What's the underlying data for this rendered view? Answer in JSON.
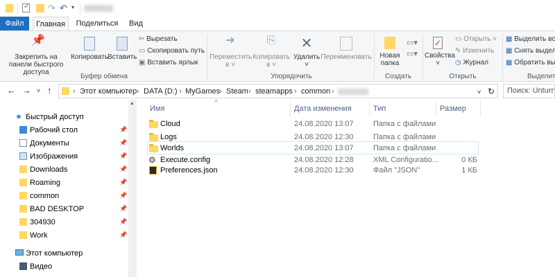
{
  "quick_access_toolbar": {
    "icons": [
      "folder-icon",
      "properties-check-icon",
      "new-folder-icon",
      "redo-icon",
      "undo-icon",
      "customize-dropdown-icon"
    ]
  },
  "ribbon_tabs": [
    {
      "label": "Файл"
    },
    {
      "label": "Главная"
    },
    {
      "label": "Поделиться"
    },
    {
      "label": "Вид"
    }
  ],
  "ribbon": {
    "clipboard": {
      "pin_label": "Закрепить на панели быстрого доступа",
      "copy_label": "Копировать",
      "paste_label": "Вставить",
      "cut_label": "Вырезать",
      "copy_path_label": "Скопировать путь",
      "paste_shortcut_label": "Вставить ярлык",
      "group_label": "Буфер обмена"
    },
    "organize": {
      "move_to_label": "Переместить в ˅",
      "copy_to_label": "Копировать в ˅",
      "delete_label": "Удалить ˅",
      "rename_label": "Переименовать",
      "group_label": "Упорядочить"
    },
    "new": {
      "new_folder_label": "Новая папка",
      "group_label": "Создать"
    },
    "open": {
      "properties_label": "Свойства ˅",
      "open_label": "Открыть ˅",
      "edit_label": "Изменить",
      "history_label": "Журнал",
      "group_label": "Открыть"
    },
    "select": {
      "select_all_label": "Выделить все",
      "select_none_label": "Снять выделение",
      "invert_label": "Обратить выделение",
      "group_label": "Выделить"
    }
  },
  "address_bar": {
    "crumbs": [
      "Этот компьютер",
      "DATA (D:)",
      "MyGames",
      "Steam",
      "steamapps",
      "common"
    ],
    "search_placeholder": "Поиск: Unturned"
  },
  "nav_pane": {
    "items": [
      {
        "label": "Быстрый доступ",
        "icon": "star-icon",
        "pinned": false
      },
      {
        "label": "Рабочий стол",
        "icon": "desktop-icon",
        "pinned": true
      },
      {
        "label": "Документы",
        "icon": "documents-icon",
        "pinned": true
      },
      {
        "label": "Изображения",
        "icon": "pictures-icon",
        "pinned": true
      },
      {
        "label": "Downloads",
        "icon": "folder-icon",
        "pinned": true
      },
      {
        "label": "Roaming",
        "icon": "folder-icon",
        "pinned": true
      },
      {
        "label": "common",
        "icon": "folder-icon",
        "pinned": true
      },
      {
        "label": "BAD DESKTOP",
        "icon": "folder-icon",
        "pinned": true
      },
      {
        "label": "304930",
        "icon": "folder-icon",
        "pinned": true
      },
      {
        "label": "Work",
        "icon": "folder-icon",
        "pinned": true
      },
      {
        "label": "Этот компьютер",
        "icon": "computer-icon",
        "pinned": false
      },
      {
        "label": "Видео",
        "icon": "video-icon",
        "pinned": false
      }
    ]
  },
  "file_list": {
    "columns": {
      "name": "Имя",
      "date": "Дата изменения",
      "type": "Тип",
      "size": "Размер"
    },
    "rows": [
      {
        "name": "Cloud",
        "date": "24.08.2020 13:07",
        "type": "Папка с файлами",
        "size": "",
        "icon": "folder-icon"
      },
      {
        "name": "Logs",
        "date": "24.08.2020 12:30",
        "type": "Папка с файлами",
        "size": "",
        "icon": "folder-icon"
      },
      {
        "name": "Worlds",
        "date": "24.08.2020 13:07",
        "type": "Папка с файлами",
        "size": "",
        "icon": "folder-icon"
      },
      {
        "name": "Execute.config",
        "date": "24.08.2020 12:28",
        "type": "XML Configuratio...",
        "size": "0 КБ",
        "icon": "config-file-icon"
      },
      {
        "name": "Preferences.json",
        "date": "24.08.2020 12:30",
        "type": "Файл \"JSON\"",
        "size": "1 КБ",
        "icon": "json-file-icon"
      }
    ]
  },
  "colors": {
    "file_tab": "#1e6fc1",
    "folder": "#ffd863",
    "selection": "#cde8ff"
  }
}
